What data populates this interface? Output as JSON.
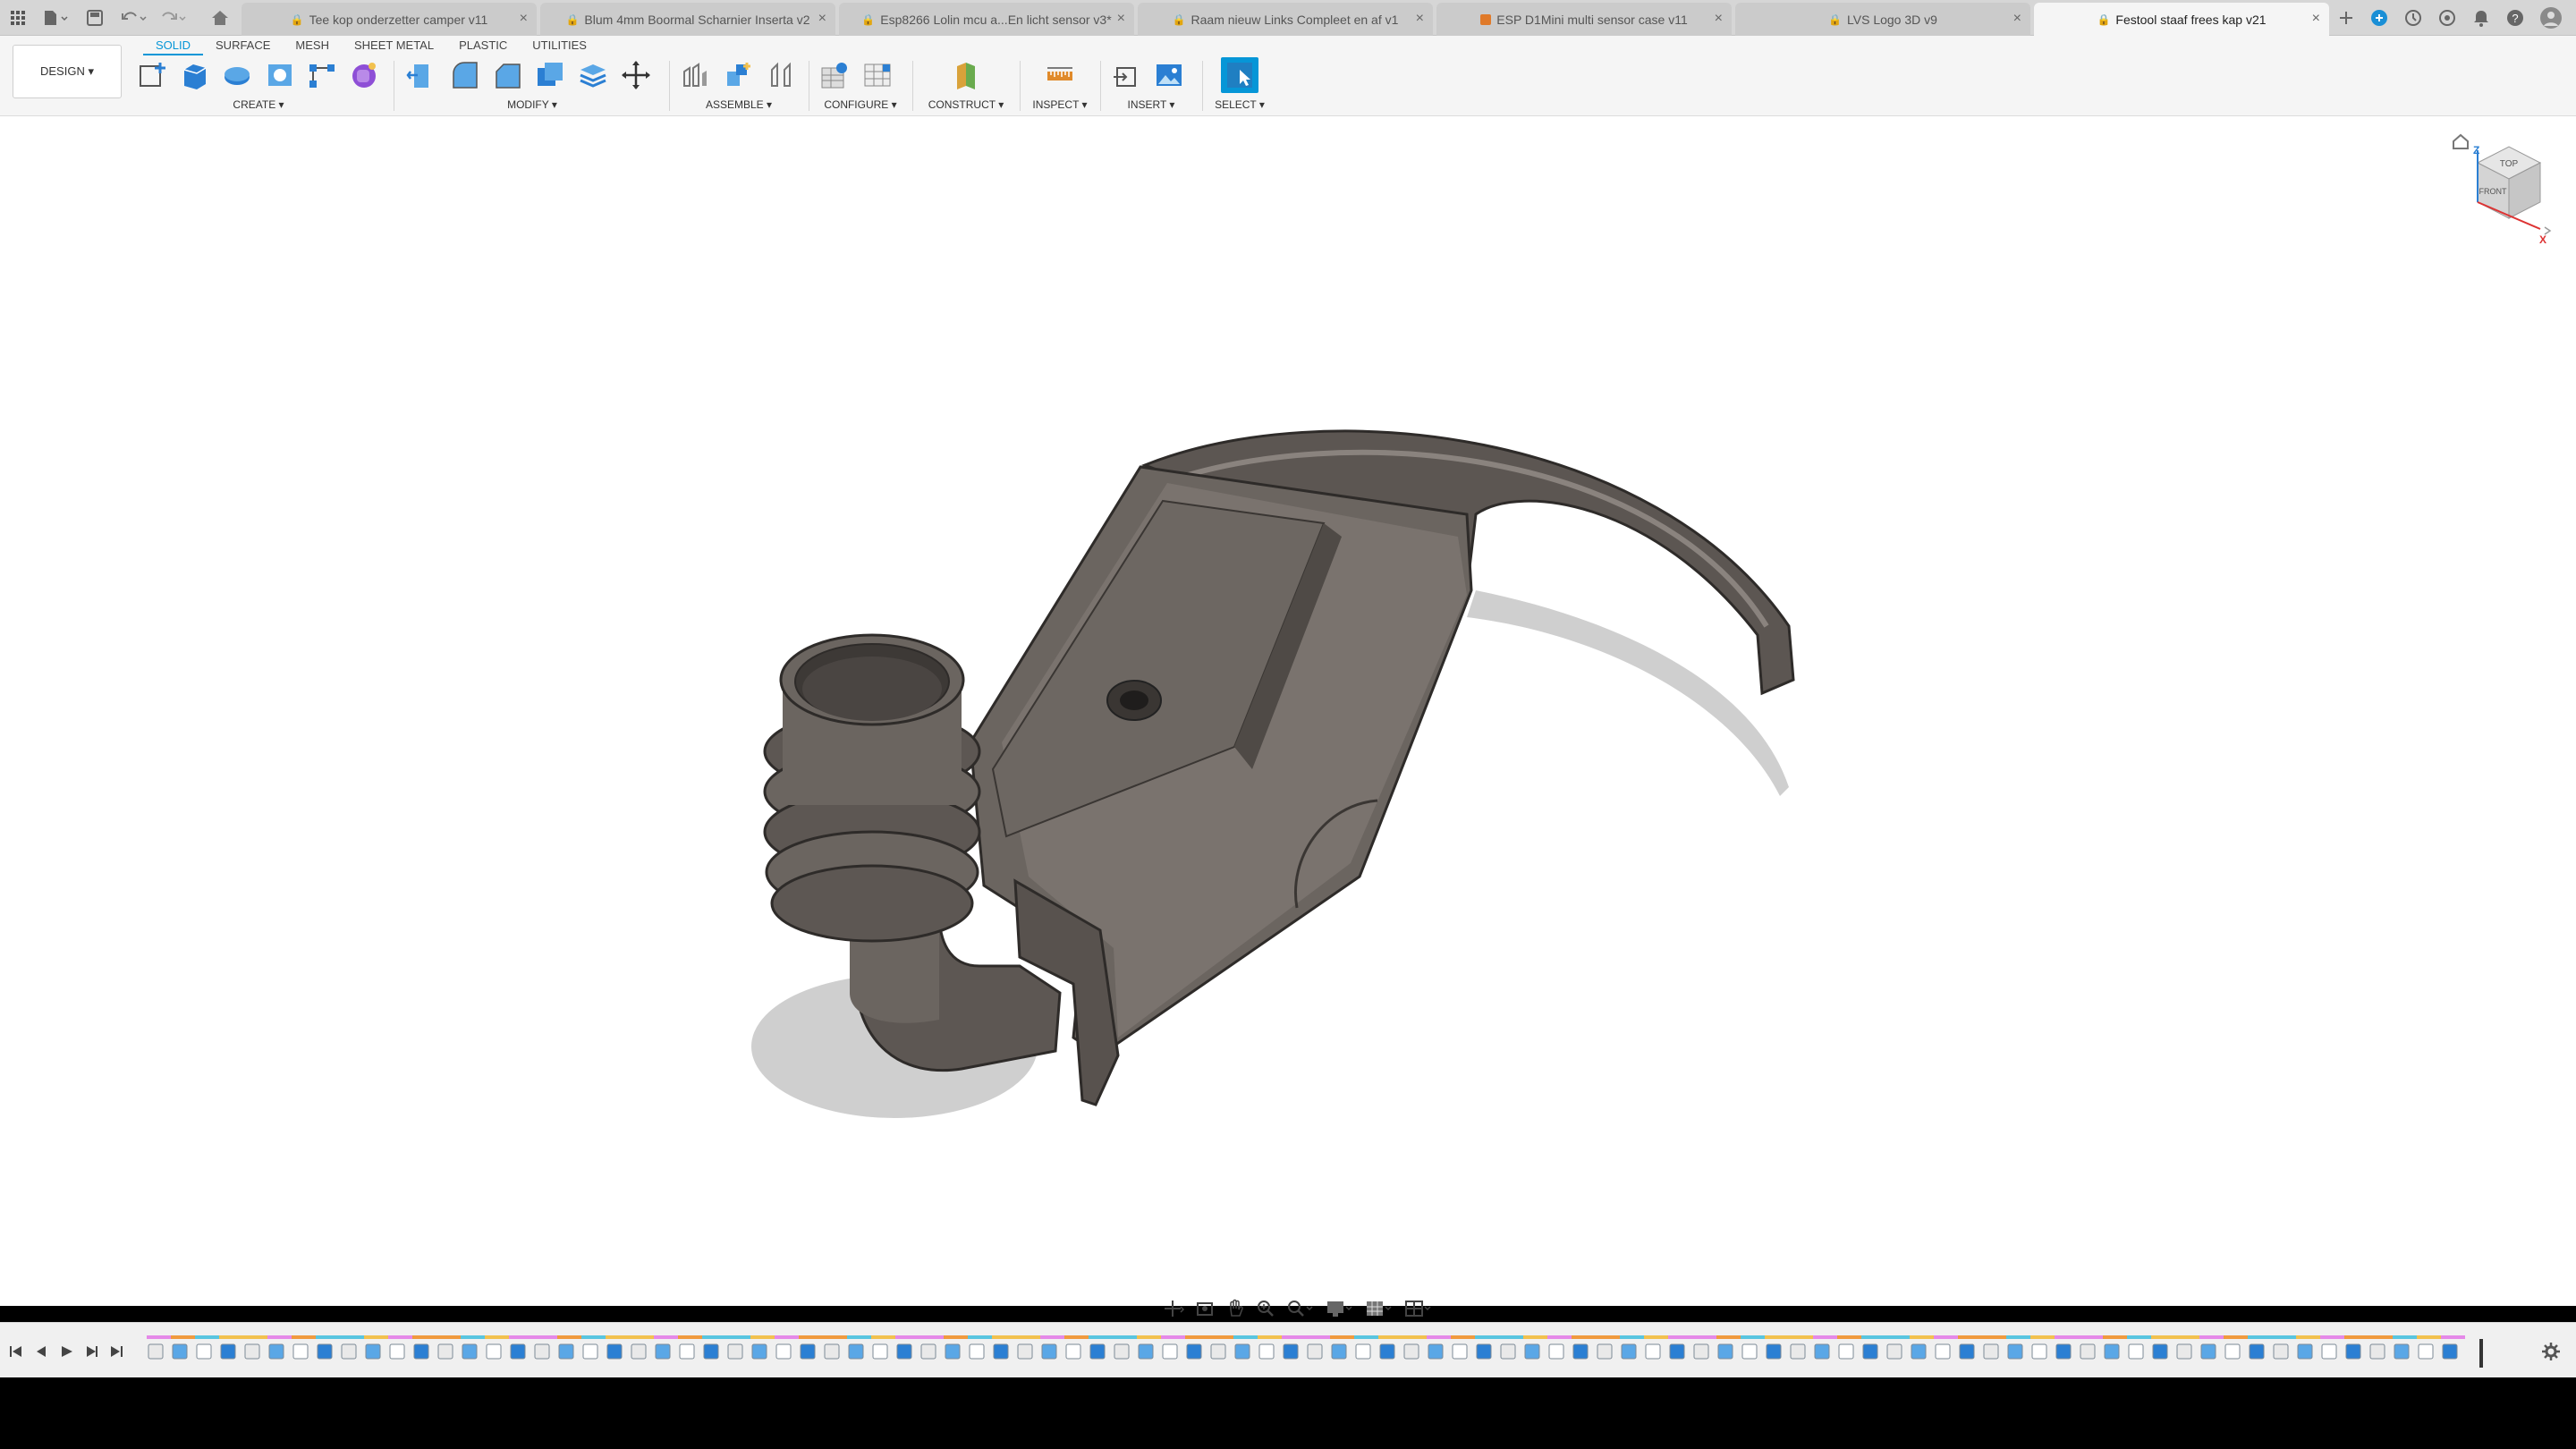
{
  "app": {
    "workspace_label": "DESIGN ▾"
  },
  "tabs": [
    {
      "title": "Tee kop onderzetter camper v11",
      "active": false,
      "locked": true
    },
    {
      "title": "Blum 4mm Boormal Scharnier Inserta v2",
      "active": false,
      "locked": true
    },
    {
      "title": "Esp8266 Lolin mcu a...En licht sensor v3*",
      "active": false,
      "locked": true
    },
    {
      "title": "Raam nieuw Links Compleet en af v1",
      "active": false,
      "locked": true
    },
    {
      "title": "ESP D1Mini multi sensor case v11",
      "active": false,
      "locked": false,
      "orange": true
    },
    {
      "title": "LVS Logo 3D v9",
      "active": false,
      "locked": true
    },
    {
      "title": "Festool staaf frees kap v21",
      "active": true,
      "locked": true
    }
  ],
  "ribbon_tabs": [
    "SOLID",
    "SURFACE",
    "MESH",
    "SHEET METAL",
    "PLASTIC",
    "UTILITIES"
  ],
  "groups": {
    "create": "CREATE ▾",
    "modify": "MODIFY ▾",
    "assemble": "ASSEMBLE ▾",
    "configure": "CONFIGURE ▾",
    "construct": "CONSTRUCT ▾",
    "inspect": "INSPECT ▾",
    "insert": "INSERT ▾",
    "select": "SELECT ▾"
  },
  "viewcube": {
    "face_top": "TOP",
    "face_front": "FRONT",
    "axis_z": "Z",
    "axis_x": "X"
  },
  "colors": {
    "accent": "#0696d7",
    "model": "#6b6560",
    "timeline_markers": [
      "#e589e8",
      "#f2c14e",
      "#59c5e0",
      "#f09a3e"
    ]
  }
}
